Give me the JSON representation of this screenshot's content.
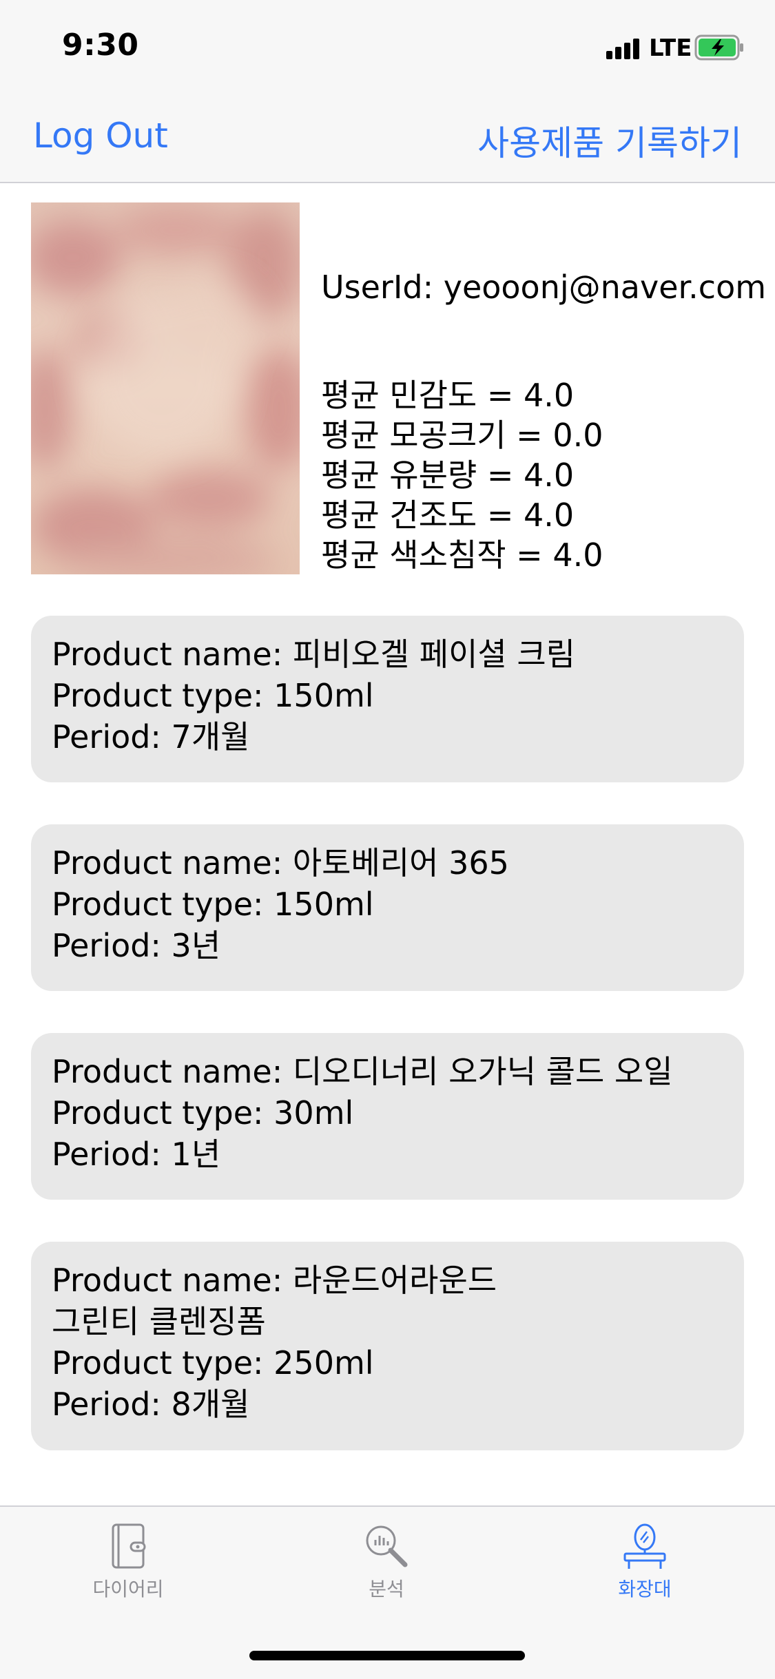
{
  "status_bar": {
    "time": "9:30",
    "network": "LTE"
  },
  "nav": {
    "left_label": "Log Out",
    "right_label": "사용제품 기록하기"
  },
  "profile": {
    "user_id": "UserId: yeooonj@naver.com",
    "stats": [
      "평균 민감도 = 4.0",
      "평균 모공크기 = 0.0",
      "평균 유분량 = 4.0",
      "평균 건조도 = 4.0",
      "평균 색소침작 = 4.0"
    ]
  },
  "products": [
    {
      "name_lines": [
        "Product name: 피비오겔 페이셜 크림"
      ],
      "type": "Product type: 150ml",
      "period": "Period: 7개월"
    },
    {
      "name_lines": [
        "Product name: 아토베리어 365"
      ],
      "type": "Product type: 150ml",
      "period": "Period: 3년"
    },
    {
      "name_lines": [
        "Product name: 디오디너리 오가닉 콜드 오일"
      ],
      "type": "Product type: 30ml",
      "period": "Period: 1년"
    },
    {
      "name_lines": [
        "Product name: 라운드어라운드",
        "그린티 클렌징폼"
      ],
      "type": "Product type: 250ml",
      "period": "Period: 8개월"
    }
  ],
  "tabs": [
    {
      "label": "다이어리",
      "icon": "diary-icon",
      "active": false
    },
    {
      "label": "분석",
      "icon": "analysis-icon",
      "active": false
    },
    {
      "label": "화장대",
      "icon": "vanity-icon",
      "active": true
    }
  ],
  "colors": {
    "accent": "#3478f6",
    "card_bg": "#e8e8e8",
    "bar_bg": "#f7f7f7",
    "inactive": "#8e8e93"
  }
}
